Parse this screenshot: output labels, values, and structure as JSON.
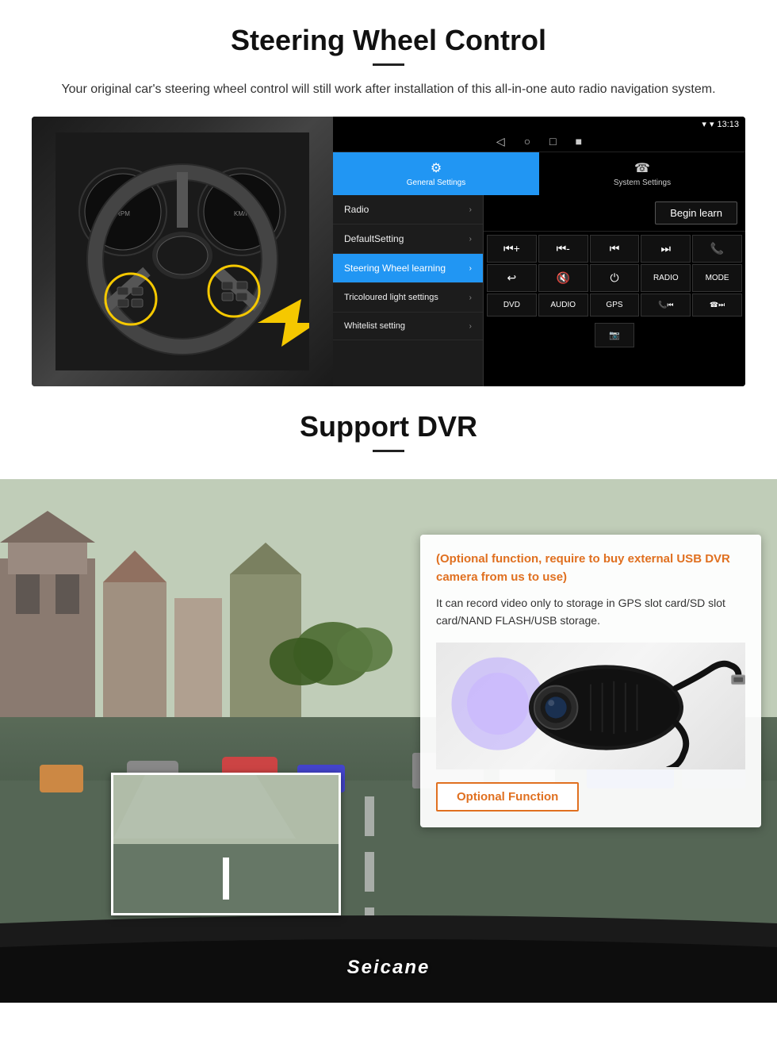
{
  "steering": {
    "title": "Steering Wheel Control",
    "subtitle": "Your original car's steering wheel control will still work after installation of this all-in-one auto radio navigation system.",
    "statusBar": {
      "signal": "▼",
      "wifi": "▾",
      "time": "13:13"
    },
    "tabs": [
      {
        "icon": "⚙",
        "label": "General Settings",
        "active": true
      },
      {
        "icon": "☎",
        "label": "System Settings",
        "active": false
      }
    ],
    "menuItems": [
      {
        "label": "Radio",
        "active": false
      },
      {
        "label": "DefaultSetting",
        "active": false
      },
      {
        "label": "Steering Wheel learning",
        "active": true
      },
      {
        "label": "Tricoloured light settings",
        "active": false
      },
      {
        "label": "Whitelist setting",
        "active": false
      }
    ],
    "beginLearn": "Begin learn",
    "controlButtons": {
      "row1": [
        "⏮+",
        "⏮-",
        "⏮⏮",
        "⏭⏭",
        "📞"
      ],
      "row2": [
        "↩",
        "🔇",
        "⏻",
        "RADIO",
        "MODE"
      ],
      "row3": [
        "DVD",
        "AUDIO",
        "GPS",
        "📞⏮",
        "☎⏭"
      ]
    }
  },
  "dvr": {
    "title": "Support DVR",
    "optionalText": "(Optional function, require to buy external USB DVR camera from us to use)",
    "descText": "It can record video only to storage in GPS slot card/SD slot card/NAND FLASH/USB storage.",
    "optionalFunctionLabel": "Optional Function",
    "watermark": "Seicane"
  }
}
